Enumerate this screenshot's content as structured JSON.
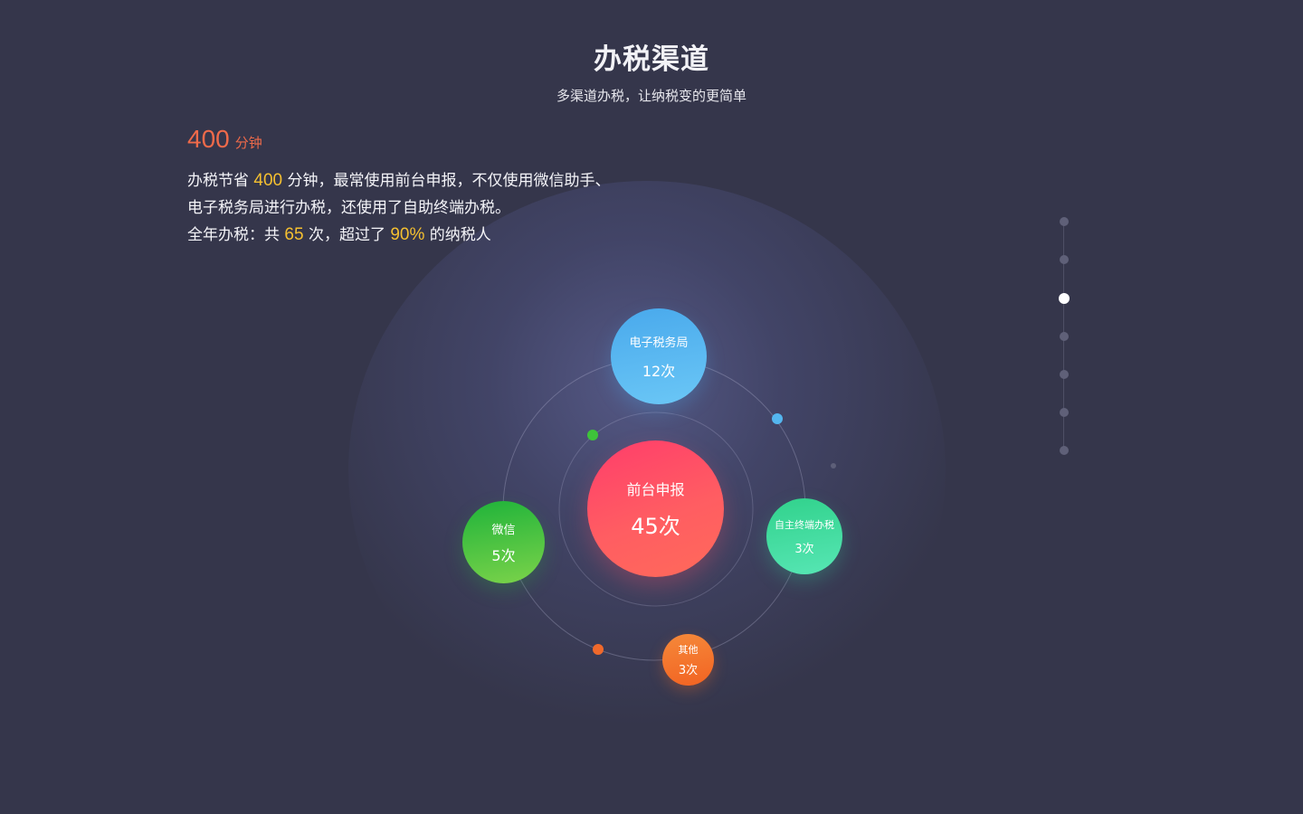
{
  "header": {
    "title": "办税渠道",
    "subtitle": "多渠道办税，让纳税变的更简单"
  },
  "stat": {
    "value": "400",
    "unit": "分钟"
  },
  "summary": {
    "line1": {
      "pre": "办税节省 ",
      "minutes": "400",
      "post": " 分钟，最常使用前台申报，不仅使用微信助手、"
    },
    "line2": "电子税务局进行办税，还使用了自助终端办税。",
    "line3": {
      "pre": "全年办税：共 ",
      "count": "65",
      "mid": " 次，超过了 ",
      "percent": "90%",
      "post": " 的纳税人"
    }
  },
  "channels": {
    "front_desk": {
      "label": "前台申报",
      "count": "45次"
    },
    "e_tax": {
      "label": "电子税务局",
      "count": "12次"
    },
    "wechat": {
      "label": "微信",
      "count": "5次"
    },
    "kiosk": {
      "label": "自主终端办税",
      "count": "3次"
    },
    "other": {
      "label": "其他",
      "count": "3次"
    }
  },
  "colors": {
    "background": "#35364b",
    "accent_orange": "#ef6a4a",
    "highlight_yellow": "#f5c030",
    "front_desk": "#ff5d62",
    "e_tax": "#49a9ec",
    "wechat": "#1fb33a",
    "kiosk": "#31d28c",
    "other": "#f26322"
  },
  "pager": {
    "total": 7,
    "active_index": 2
  }
}
